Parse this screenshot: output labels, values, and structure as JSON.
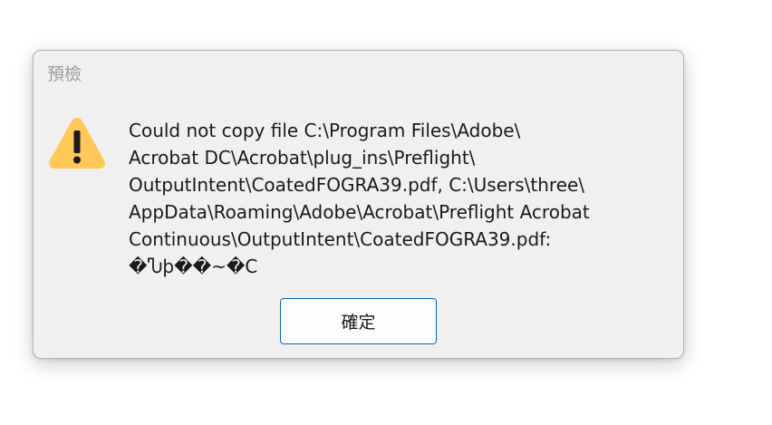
{
  "dialog": {
    "title": "預檢",
    "icon": "warning-icon",
    "message_lines": [
      "Could not copy file C:\\Program Files\\Adobe\\",
      "Acrobat DC\\Acrobat\\plug_ins\\Preflight\\",
      "OutputIntent\\CoatedFOGRA39.pdf, C:\\Users\\three\\",
      "AppData\\Roaming\\Adobe\\Acrobat\\Preflight Acrobat",
      "Continuous\\OutputIntent\\CoatedFOGRA39.pdf:",
      "�Ⴠþ��~�C"
    ],
    "ok_label": "確定"
  },
  "colors": {
    "dialog_background": "#f0f0f0",
    "warning_fill": "#ffc857",
    "button_border": "#0067c0"
  }
}
